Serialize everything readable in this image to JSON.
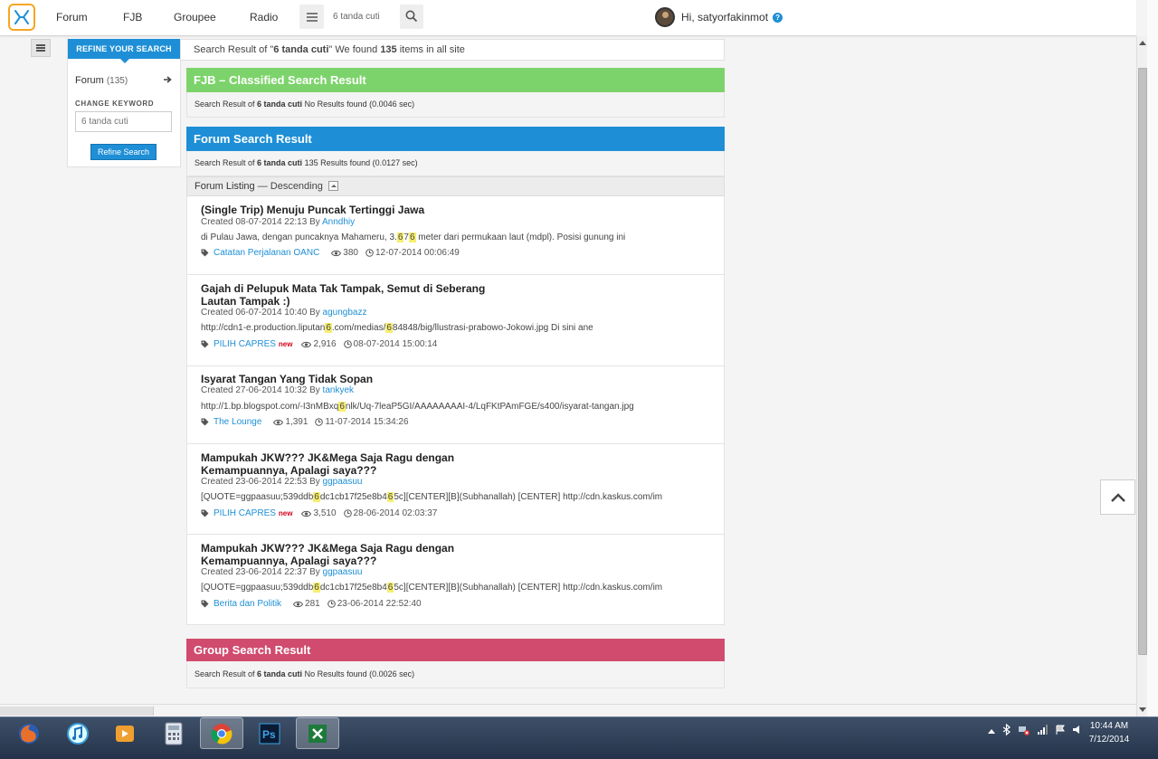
{
  "header": {
    "nav": [
      "Forum",
      "FJB",
      "Groupee",
      "Radio"
    ],
    "search_value": "6 tanda cuti",
    "greeting": "Hi, satyorfakinmot",
    "help": "?"
  },
  "sidebar": {
    "tab": "REFINE YOUR SEARCH",
    "forum_label": "Forum",
    "forum_count": "(135)",
    "change_keyword_label": "CHANGE KEYWORD",
    "keyword_placeholder": "6 tanda cuti",
    "refine_button": "Refine Search"
  },
  "summary": {
    "prefix": "Search Result of \"",
    "keyword": "6 tanda cuti",
    "middle": "\" We found ",
    "count": "135",
    "suffix": " items in all site"
  },
  "fjb": {
    "title": "FJB – Classified Search Result",
    "prefix": "Search Result of ",
    "keyword": "6 tanda cuti",
    "suffix": "  No Results found (0.0046 sec)",
    "color": "#7dd36b"
  },
  "forum": {
    "title": "Forum Search Result",
    "prefix": "Search Result of ",
    "keyword": "6 tanda cuti",
    "suffix": " 135 Results found (0.0127 sec)",
    "color": "#1e8fd6",
    "listing_label": "Forum Listing",
    "listing_sort": " — Descending",
    "items": [
      {
        "title": "(Single Trip) Menuju Puncak Tertinggi Jawa",
        "created": "Created 08-07-2014 22:13 By ",
        "author": "Anndhiy",
        "snippet": [
          {
            "t": "di Pulau Jawa, dengan puncaknya Mahameru, 3."
          },
          {
            "t": "6",
            "h": true
          },
          {
            "t": "7"
          },
          {
            "t": "6",
            "h": true
          },
          {
            "t": " meter dari permukaan laut (mdpl). Posisi gunung ini"
          }
        ],
        "category": "Catatan Perjalanan OANC",
        "new": "",
        "views": "380",
        "time": "12-07-2014 00:06:49"
      },
      {
        "title": "Gajah di Pelupuk Mata Tak Tampak, Semut di Seberang Lautan Tampak :)",
        "created": "Created 06-07-2014 10:40 By ",
        "author": "agungbazz",
        "snippet": [
          {
            "t": "http://cdn1-e.production.liputan"
          },
          {
            "t": "6",
            "h": true
          },
          {
            "t": ".com/medias/"
          },
          {
            "t": "6",
            "h": true
          },
          {
            "t": "84848/big/llustrasi-prabowo-Jokowi.jpg Di sini ane"
          }
        ],
        "category": "PILIH CAPRES",
        "new": "new",
        "views": "2,916",
        "time": "08-07-2014 15:00:14"
      },
      {
        "title": "Isyarat Tangan Yang Tidak Sopan",
        "created": "Created 27-06-2014 10:32 By ",
        "author": "tankyek",
        "snippet": [
          {
            "t": "http://1.bp.blogspot.com/-I3nMBxq"
          },
          {
            "t": "6",
            "h": true
          },
          {
            "t": "nlk/Uq-7leaP5GI/AAAAAAAAI-4/LqFKtPAmFGE/s400/isyarat-tangan.jpg"
          }
        ],
        "category": "The Lounge",
        "new": "",
        "views": "1,391",
        "time": "11-07-2014 15:34:26"
      },
      {
        "title": "Mampukah JKW??? JK&Mega Saja Ragu dengan Kemampuannya, Apalagi saya???",
        "created": "Created 23-06-2014 22:53 By ",
        "author": "ggpaasuu",
        "snippet": [
          {
            "t": "[QUOTE=ggpaasuu;539ddb"
          },
          {
            "t": "6",
            "h": true
          },
          {
            "t": "dc1cb17f25e8b4"
          },
          {
            "t": "6",
            "h": true
          },
          {
            "t": "5c][CENTER][B](Subhanallah) [CENTER] http://cdn.kaskus.com/im"
          }
        ],
        "category": "PILIH CAPRES",
        "new": "new",
        "views": "3,510",
        "time": "28-06-2014 02:03:37"
      },
      {
        "title": "Mampukah JKW??? JK&Mega Saja Ragu dengan Kemampuannya, Apalagi saya???",
        "created": "Created 23-06-2014 22:37 By ",
        "author": "ggpaasuu",
        "snippet": [
          {
            "t": "[QUOTE=ggpaasuu;539ddb"
          },
          {
            "t": "6",
            "h": true
          },
          {
            "t": "dc1cb17f25e8b4"
          },
          {
            "t": "6",
            "h": true
          },
          {
            "t": "5c][CENTER][B](Subhanallah) [CENTER] http://cdn.kaskus.com/im"
          }
        ],
        "category": "Berita dan Politik",
        "new": "",
        "views": "281",
        "time": "23-06-2014 22:52:40"
      }
    ]
  },
  "group": {
    "title": "Group Search Result",
    "prefix": "Search Result of ",
    "keyword": "6 tanda cuti",
    "suffix": " No Results found (0.0026 sec)",
    "color": "#d14b6e"
  },
  "taskbar": {
    "apps": [
      "firefox",
      "itunes",
      "media-player",
      "calculator",
      "chrome",
      "photoshop",
      "excel"
    ],
    "clock_time": "10:44 AM",
    "clock_date": "7/12/2014"
  }
}
